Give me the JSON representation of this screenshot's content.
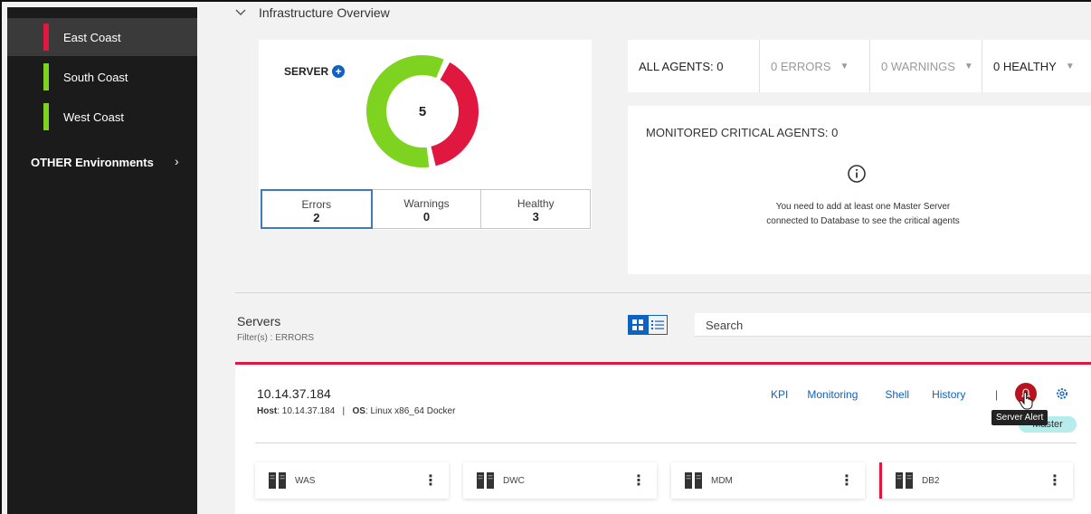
{
  "sidebar": {
    "environments": [
      {
        "label": "East Coast",
        "color": "#e0173f",
        "active": true
      },
      {
        "label": "South Coast",
        "color": "#7ed321",
        "active": false
      },
      {
        "label": "West Coast",
        "color": "#7ed321",
        "active": false
      }
    ],
    "other_label": "OTHER Environments"
  },
  "overview": {
    "title": "Infrastructure Overview",
    "server_label": "SERVER",
    "total": "5",
    "stats": [
      {
        "label": "Errors",
        "value": "2"
      },
      {
        "label": "Warnings",
        "value": "0"
      },
      {
        "label": "Healthy",
        "value": "3"
      }
    ],
    "donut": {
      "errors": 2,
      "warnings": 0,
      "healthy": 3,
      "error_color": "#e0173f",
      "healthy_color": "#7ed321"
    }
  },
  "agents": {
    "all": "ALL AGENTS: 0",
    "errors": "0 ERRORS",
    "warnings": "0 WARNINGS",
    "healthy": "0 HEALTHY",
    "critical_title": "MONITORED CRITICAL AGENTS: 0",
    "critical_msg_1": "You need to add at least one Master Server",
    "critical_msg_2": "connected to Database to see the critical agents"
  },
  "servers": {
    "title": "Servers",
    "filter": "Filter(s) : ERRORS",
    "search_placeholder": "Search"
  },
  "server_detail": {
    "name": "10.14.37.184",
    "host_label": "Host",
    "host_value": ": 10.14.37.184",
    "sep": "|",
    "os_label": "OS",
    "os_value": ": Linux x86_64 Docker",
    "links": [
      "KPI",
      "Monitoring",
      "Shell",
      "History"
    ],
    "pipe": "|",
    "tooltip": "Server Alert",
    "badge": "Master",
    "components": [
      {
        "name": "WAS",
        "error": false
      },
      {
        "name": "DWC",
        "error": false
      },
      {
        "name": "MDM",
        "error": false
      },
      {
        "name": "DB2",
        "error": true
      }
    ]
  },
  "colors": {
    "accent": "#0f62c0",
    "error": "#e0173f",
    "healthy": "#7ed321",
    "badge": "#b7ecec"
  }
}
